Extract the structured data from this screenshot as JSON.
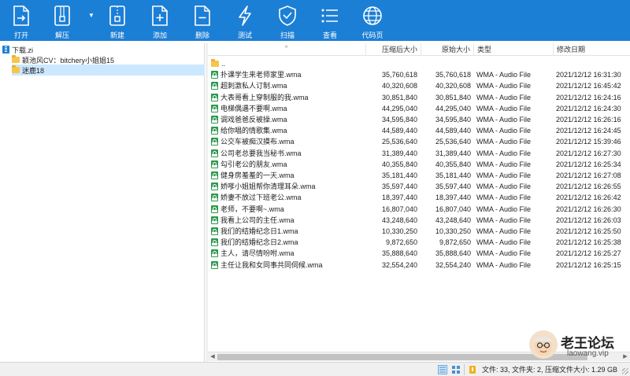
{
  "toolbar": {
    "buttons": [
      {
        "label": "打开",
        "icon": "open-file-icon"
      },
      {
        "label": "解压",
        "icon": "extract-icon"
      },
      {
        "label": "新建",
        "icon": "new-archive-icon"
      },
      {
        "label": "添加",
        "icon": "add-file-icon"
      },
      {
        "label": "删除",
        "icon": "delete-file-icon"
      },
      {
        "label": "测试",
        "icon": "test-lightning-icon"
      },
      {
        "label": "扫描",
        "icon": "scan-shield-icon"
      },
      {
        "label": "查看",
        "icon": "view-list-icon"
      },
      {
        "label": "代码页",
        "icon": "globe-icon"
      }
    ],
    "background_color": "#1c7fd6"
  },
  "tree": {
    "root": "下载.zi",
    "items": [
      {
        "label": "颖池风CV：bitchery小姐姐15",
        "selected": false
      },
      {
        "label": "迷鹿18",
        "selected": true
      }
    ]
  },
  "list": {
    "columns": {
      "name": "",
      "compressed_size": "压缩后大小",
      "original_size": "原始大小",
      "type": "类型",
      "modified": "修改日期"
    },
    "parent_dir": "..",
    "rows": [
      {
        "name": "扑课学生来老师家里.wma",
        "csize": "35,760,618",
        "osize": "35,760,618",
        "type": "WMA - Audio File",
        "date": "2021/12/12 16:31:30"
      },
      {
        "name": "超刺激私人订制.wma",
        "csize": "40,320,608",
        "osize": "40,320,608",
        "type": "WMA - Audio File",
        "date": "2021/12/12 16:45:42"
      },
      {
        "name": "大表哥看上穿制服的我.wma",
        "csize": "30,851,840",
        "osize": "30,851,840",
        "type": "WMA - Audio File",
        "date": "2021/12/12 16:24:16"
      },
      {
        "name": "电梯偶遇不要啊.wma",
        "csize": "44,295,040",
        "osize": "44,295,040",
        "type": "WMA - Audio File",
        "date": "2021/12/12 16:24:30"
      },
      {
        "name": "调戏爸爸反被操.wma",
        "csize": "34,595,840",
        "osize": "34,595,840",
        "type": "WMA - Audio File",
        "date": "2021/12/12 16:26:16"
      },
      {
        "name": "给你唱的情歌集.wma",
        "csize": "44,589,440",
        "osize": "44,589,440",
        "type": "WMA - Audio File",
        "date": "2021/12/12 16:24:45"
      },
      {
        "name": "公交车被痴汉摸布.wma",
        "csize": "25,536,640",
        "osize": "25,536,640",
        "type": "WMA - Audio File",
        "date": "2021/12/12 15:39:46"
      },
      {
        "name": "公司老总要我当秘书.wma",
        "csize": "31,389,440",
        "osize": "31,389,440",
        "type": "WMA - Audio File",
        "date": "2021/12/12 16:27:30"
      },
      {
        "name": "勾引老公的朋友.wma",
        "csize": "40,355,840",
        "osize": "40,355,840",
        "type": "WMA - Audio File",
        "date": "2021/12/12 16:25:34"
      },
      {
        "name": "健身房羞羞的一天.wma",
        "csize": "35,181,440",
        "osize": "35,181,440",
        "type": "WMA - Audio File",
        "date": "2021/12/12 16:27:08"
      },
      {
        "name": "娇嗲小姐姐帮你清理耳朵.wma",
        "csize": "35,597,440",
        "osize": "35,597,440",
        "type": "WMA - Audio File",
        "date": "2021/12/12 16:26:55"
      },
      {
        "name": "娇妻不放过下班老公.wma",
        "csize": "18,397,440",
        "osize": "18,397,440",
        "type": "WMA - Audio File",
        "date": "2021/12/12 16:26:42"
      },
      {
        "name": "老师，不要啊~.wma",
        "csize": "16,807,040",
        "osize": "16,807,040",
        "type": "WMA - Audio File",
        "date": "2021/12/12 16:26:30"
      },
      {
        "name": "我看上公司的主任.wma",
        "csize": "43,248,640",
        "osize": "43,248,640",
        "type": "WMA - Audio File",
        "date": "2021/12/12 16:26:03"
      },
      {
        "name": "我们的结婚纪念日1.wma",
        "csize": "10,330,250",
        "osize": "10,330,250",
        "type": "WMA - Audio File",
        "date": "2021/12/12 16:25:50"
      },
      {
        "name": "我们的结婚纪念日2.wma",
        "csize": "9,872,650",
        "osize": "9,872,650",
        "type": "WMA - Audio File",
        "date": "2021/12/12 16:25:38"
      },
      {
        "name": "主人，请尽情吩咐.wma",
        "csize": "35,888,640",
        "osize": "35,888,640",
        "type": "WMA - Audio File",
        "date": "2021/12/12 16:25:27"
      },
      {
        "name": "主任让我和女同事共同伺候.wma",
        "csize": "32,554,240",
        "osize": "32,554,240",
        "type": "WMA - Audio File",
        "date": "2021/12/12 16:25:15"
      }
    ]
  },
  "statusbar": {
    "text": "文件: 33, 文件夹: 2, 压缩文件大小: 1.29 GB"
  },
  "watermark": {
    "title": "老王论坛",
    "url": "laowang.vip"
  }
}
